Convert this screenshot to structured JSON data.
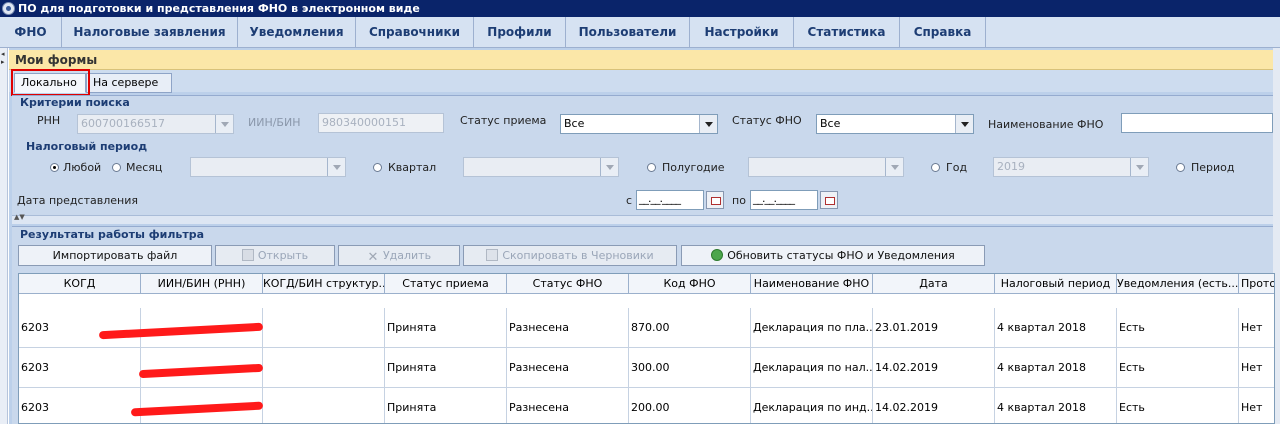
{
  "window": {
    "title": "ПО для подготовки и представления ФНО в электронном виде"
  },
  "menu": [
    "ФНО",
    "Налоговые заявления",
    "Уведомления",
    "Справочники",
    "Профили",
    "Пользователи",
    "Настройки",
    "Статистика",
    "Справка"
  ],
  "section_title": "Мои формы",
  "tabs": [
    "Локально",
    "На сервере"
  ],
  "criteria": {
    "title": "Критерии поиска",
    "rnn_label": "РНН",
    "rnn_value": "600700166517",
    "iin_label": "ИИН/БИН",
    "iin_value": "980340000151",
    "status_label": "Статус приема",
    "status_value": "Все",
    "fno_status_label": "Статус ФНО",
    "fno_status_value": "Все",
    "fno_name_label": "Наименование ФНО",
    "fno_name_value": ""
  },
  "period": {
    "title": "Налоговый период",
    "any": "Любой",
    "month": "Месяц",
    "quarter": "Квартал",
    "halfyear": "Полугодие",
    "year": "Год",
    "year_value": "2019",
    "period": "Период"
  },
  "submit_date": {
    "label": "Дата представления",
    "from": "с",
    "to": "по",
    "from_value": "__.__.____",
    "to_value": "__.__.____"
  },
  "results": {
    "title": "Результаты работы фильтра",
    "buttons": {
      "import": "Импортировать файл",
      "open": "Открыть",
      "delete": "Удалить",
      "copy": "Скопировать в Черновики",
      "refresh": "Обновить статусы ФНО и Уведомления"
    },
    "columns": [
      "КОГД",
      "ИИН/БИН (РНН)",
      "КОГД/БИН структур...",
      "Статус приема",
      "Статус ФНО",
      "Код ФНО",
      "Наименование ФНО",
      "Дата",
      "Налоговый период",
      "Уведомления (есть...",
      "Прото"
    ],
    "rows": [
      {
        "kogd": "6203",
        "iin": "",
        "struct": "",
        "status": "Принята",
        "fno_status": "Разнесена",
        "code": "870.00",
        "name": "Декларация по пла...",
        "date": "23.01.2019",
        "period": "4 квартал 2018",
        "notice": "Есть",
        "proto": "Нет"
      },
      {
        "kogd": "6203",
        "iin": "",
        "struct": "",
        "status": "Принята",
        "fno_status": "Разнесена",
        "code": "300.00",
        "name": "Декларация по нал...",
        "date": "14.02.2019",
        "period": "4 квартал 2018",
        "notice": "Есть",
        "proto": "Нет"
      },
      {
        "kogd": "6203",
        "iin": "",
        "struct": "",
        "status": "Принята",
        "fno_status": "Разнесена",
        "code": "200.00",
        "name": "Декларация по инд...",
        "date": "14.02.2019",
        "period": "4 квартал 2018",
        "notice": "Есть",
        "proto": "Нет"
      }
    ]
  }
}
